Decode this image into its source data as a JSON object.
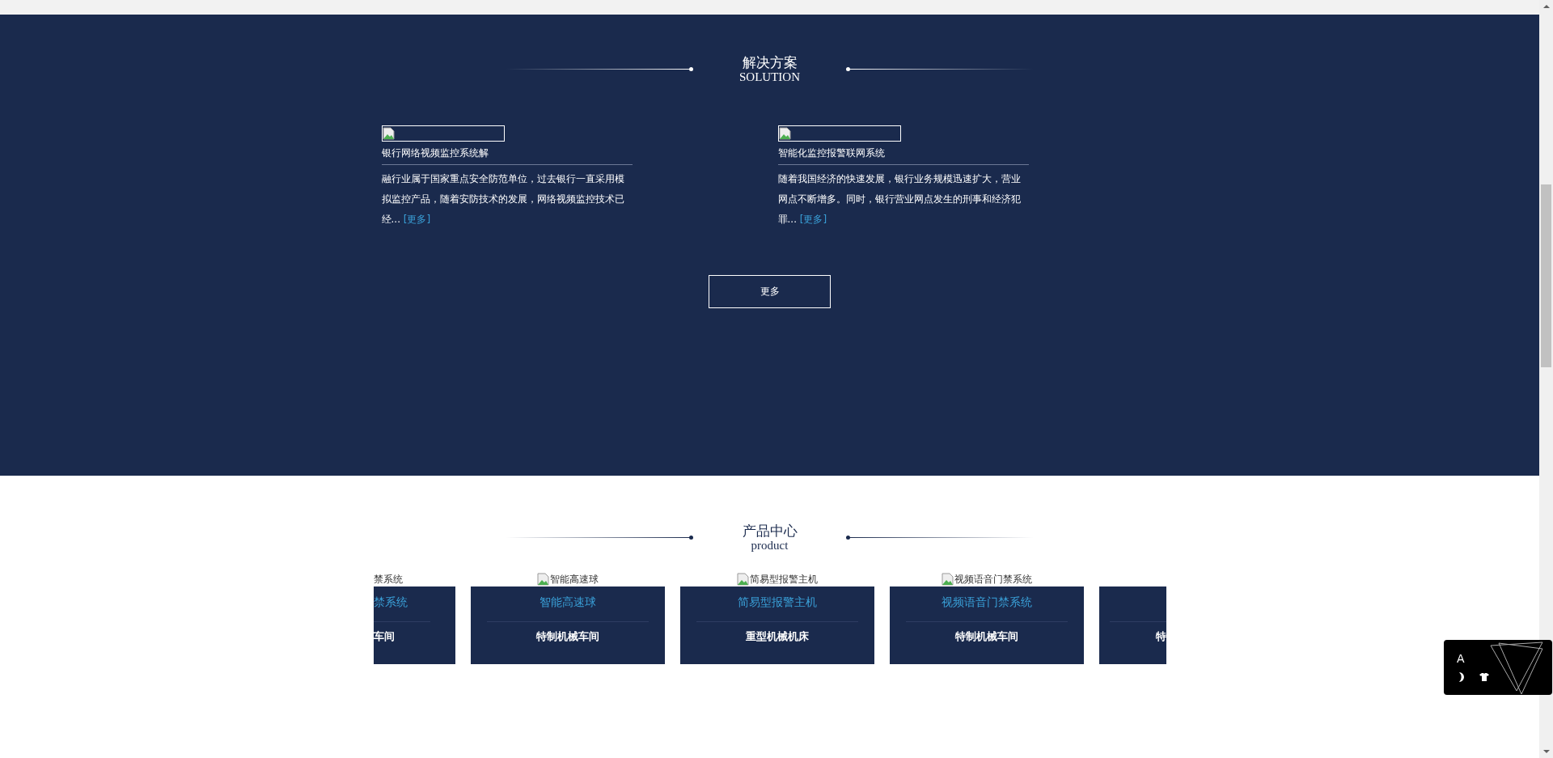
{
  "solution": {
    "title": "解决方案",
    "subtitle": "SOLUTION",
    "items": [
      {
        "title": "银行网络视频监控系统解",
        "text": "融行业属于国家重点安全防范单位，过去银行一直采用模拟监控产品，随着安防技术的发展，网络视频监控技术已经...",
        "link": "[更多]"
      },
      {
        "title": "智能化监控报警联网系统",
        "text": "随着我国经济的快速发展，银行业务规模迅速扩大，营业网点不断增多。同时，银行营业网点发生的刑事和经济犯罪...",
        "link": "[更多]"
      }
    ],
    "more_button": "更多"
  },
  "products": {
    "title": "产品中心",
    "subtitle": "product",
    "items": [
      {
        "kind": "cut-left",
        "image_alt": "禁系统",
        "title": "禁系统",
        "subtitle": "车间"
      },
      {
        "kind": "full",
        "image_alt": "智能高速球",
        "title": "智能高速球",
        "subtitle": "特制机械车间"
      },
      {
        "kind": "full",
        "image_alt": "简易型报警主机",
        "title": "简易型报警主机",
        "subtitle": "重型机械机床"
      },
      {
        "kind": "full",
        "image_alt": "视频语音门禁系统",
        "title": "视频语音门禁系统",
        "subtitle": "特制机械车间"
      },
      {
        "kind": "cut-right",
        "subtitle": "特"
      }
    ]
  },
  "widget": {
    "letter": "A"
  }
}
